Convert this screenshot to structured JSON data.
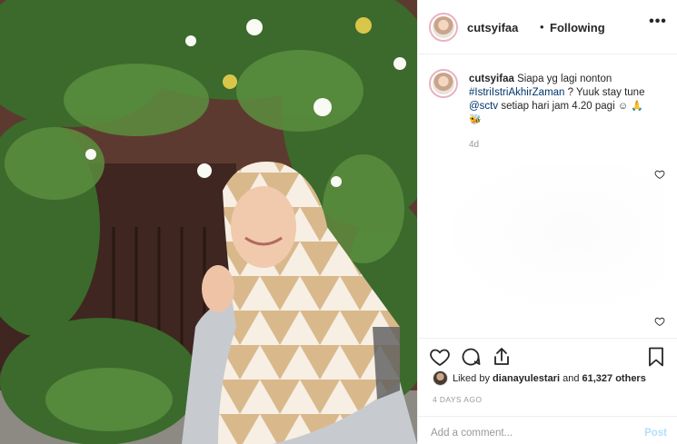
{
  "header": {
    "username": "cutsyifaa",
    "separator": "•",
    "follow_status": "Following",
    "more_label": "•••"
  },
  "caption": {
    "username": "cutsyifaa",
    "text_1": "Siapa yg lagi nonton",
    "hashtag": "#IstriIstriAkhirZaman",
    "text_2": "? Yuuk stay tune",
    "mention": "@sctv",
    "text_3": "setiap hari jam 4.20 pagi",
    "emoji_1": "☺",
    "emoji_2": "🙏",
    "emoji_3": "🐝",
    "age": "4d"
  },
  "likes": {
    "prefix": "Liked by",
    "user": "dianayulestari",
    "conjunction": "and",
    "count": "61,327 others"
  },
  "timestamp": "4 DAYS AGO",
  "comment": {
    "placeholder": "Add a comment...",
    "post_label": "Post"
  },
  "colors": {
    "text": "#262626",
    "muted": "#999999",
    "link": "#003569",
    "post_disabled": "#b2dffc",
    "story_ring": "#e8b3c0"
  },
  "icons": [
    "heart-icon",
    "comment-icon",
    "share-icon",
    "bookmark-icon",
    "more-icon"
  ]
}
